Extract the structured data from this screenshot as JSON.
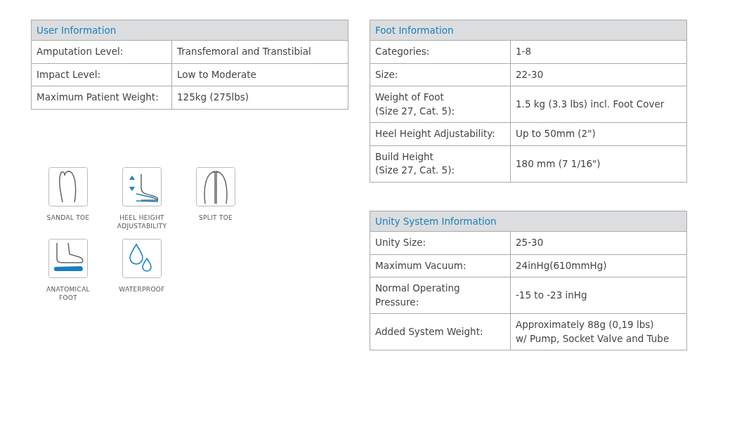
{
  "user_information": {
    "title": "User Information",
    "rows": [
      {
        "label": "Amputation Level:",
        "value": "Transfemoral and Transtibial"
      },
      {
        "label": "Impact Level:",
        "value": "Low to Moderate"
      },
      {
        "label": "Maximum Patient Weight:",
        "value": "125kg (275lbs)"
      }
    ]
  },
  "features": [
    {
      "kind": "sandal_toe",
      "label": "SANDAL TOE"
    },
    {
      "kind": "heel_height",
      "label": "HEEL HEIGHT\nADJUSTABILITY"
    },
    {
      "kind": "split_toe",
      "label": "SPLIT TOE"
    },
    {
      "kind": "anatomical",
      "label": "ANATOMICAL\nFOOT"
    },
    {
      "kind": "waterproof",
      "label": "WATERPROOF"
    }
  ],
  "foot_information": {
    "title": "Foot Information",
    "rows": [
      {
        "label": "Categories:",
        "value": "1-8"
      },
      {
        "label": "Size:",
        "value": "22-30"
      },
      {
        "label": "Weight of Foot\n(Size 27, Cat. 5):",
        "value": "1.5 kg (3.3 lbs) incl. Foot Cover"
      },
      {
        "label": "Heel Height Adjustability:",
        "value": "Up to 50mm (2\")"
      },
      {
        "label": "Build Height\n(Size 27, Cat. 5):",
        "value": "180 mm (7 1/16\")"
      }
    ]
  },
  "unity_system_information": {
    "title": "Unity System Information",
    "rows": [
      {
        "label": "Unity Size:",
        "value": "25-30"
      },
      {
        "label": "Maximum Vacuum:",
        "value": "24inHg(610mmHg)"
      },
      {
        "label": "Normal Operating\nPressure:",
        "value": "-15 to -23 inHg"
      },
      {
        "label": "Added System Weight:",
        "value": "Approximately 88g (0,19 lbs)\nw/ Pump, Socket Valve and Tube"
      }
    ]
  }
}
